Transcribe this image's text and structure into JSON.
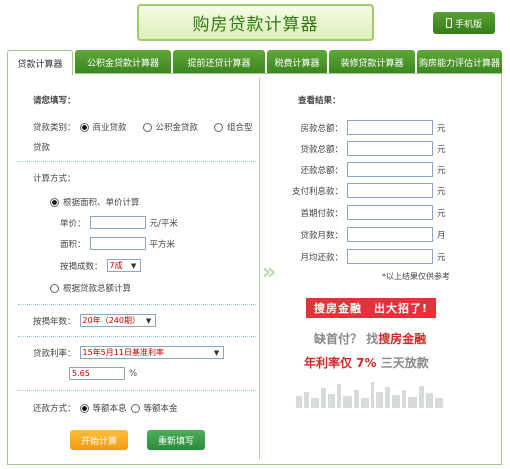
{
  "page_title": "购房贷款计算器",
  "mobile_button": "手机版",
  "tabs": [
    "贷款计算器",
    "公积金贷款计算器",
    "提前还贷计算器",
    "税费计算器",
    "装修贷款计算器",
    "购房能力评估计算器"
  ],
  "left": {
    "heading": "请您填写：",
    "loan_type_label": "贷款类别：",
    "loan_types": [
      "商业贷款",
      "公积金贷款",
      "组合型"
    ],
    "loan_type_suffix": "贷款",
    "calc_method_label": "计算方式：",
    "method_area": "根据面积、单价计算",
    "unit_price_label": "单价：",
    "unit_price_unit": "元/平米",
    "area_label": "面积：",
    "area_unit": "平方米",
    "mortgage_ratio_label": "按揭成数：",
    "mortgage_ratio_value": "7成",
    "method_total": "根据贷款总额计算",
    "years_label": "按揭年数：",
    "years_value": "20年（240期）",
    "rate_label": "贷款利率：",
    "rate_select": "15年5月11日基准利率",
    "rate_value": "5.65",
    "rate_unit": "%",
    "repay_label": "还款方式：",
    "repay_options": [
      "等额本息",
      "等额本金"
    ],
    "calc_button": "开始计算",
    "reset_button": "重新填写"
  },
  "right": {
    "heading": "查看结果：",
    "fields": [
      {
        "label": "房款总额：",
        "unit": "元"
      },
      {
        "label": "贷款总额：",
        "unit": "元"
      },
      {
        "label": "还款总额：",
        "unit": "元"
      },
      {
        "label": "支付利息款：",
        "unit": "元"
      },
      {
        "label": "首期付款：",
        "unit": "元"
      },
      {
        "label": "贷款月数：",
        "unit": "月"
      },
      {
        "label": "月均还款：",
        "unit": "元"
      }
    ],
    "note": "*以上结果仅供参考"
  },
  "ad": {
    "banner": "搜房金融　出大招了!",
    "line1_a": "缺首付？",
    "line1_b": "找",
    "line1_c": "搜房金融",
    "line2_a": "年利率仅 7%",
    "line2_b": "三天放款"
  }
}
